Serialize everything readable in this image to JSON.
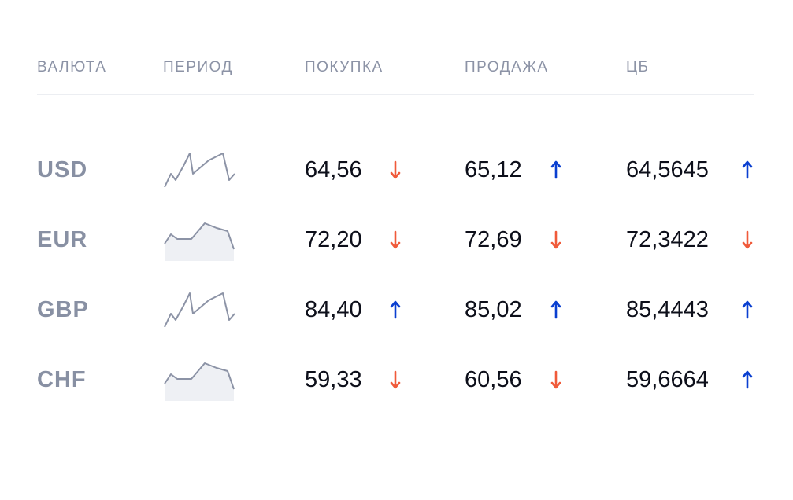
{
  "columns": {
    "currency": "ВАЛЮТА",
    "period": "ПЕРИОД",
    "buy": "ПОКУПКА",
    "sell": "ПРОДАЖА",
    "cb": "ЦБ"
  },
  "colors": {
    "up": "#0a3fd0",
    "down": "#f05a3a",
    "sparkline": "#8c93a6"
  },
  "rows": [
    {
      "code": "USD",
      "sparkline": "volatile",
      "buy": "64,56",
      "buy_trend": "down",
      "sell": "65,12",
      "sell_trend": "up",
      "cb": "64,5645",
      "cb_trend": "up"
    },
    {
      "code": "EUR",
      "sparkline": "smooth",
      "buy": "72,20",
      "buy_trend": "down",
      "sell": "72,69",
      "sell_trend": "down",
      "cb": "72,3422",
      "cb_trend": "down"
    },
    {
      "code": "GBP",
      "sparkline": "volatile",
      "buy": "84,40",
      "buy_trend": "up",
      "sell": "85,02",
      "sell_trend": "up",
      "cb": "85,4443",
      "cb_trend": "up"
    },
    {
      "code": "CHF",
      "sparkline": "smooth",
      "buy": "59,33",
      "buy_trend": "down",
      "sell": "60,56",
      "sell_trend": "down",
      "cb": "59,6664",
      "cb_trend": "up"
    }
  ]
}
